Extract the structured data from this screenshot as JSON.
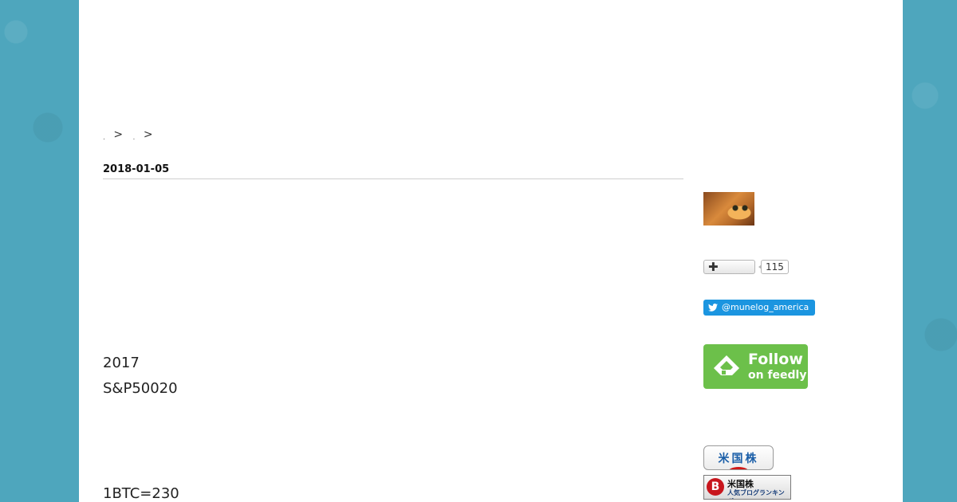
{
  "breadcrumb": {
    "separator_1": ">",
    "separator_2": ">"
  },
  "article": {
    "date": "2018-01-05",
    "line_1": "2017",
    "line_2": "S&P50020",
    "line_3": "1BTC=230"
  },
  "sidebar": {
    "hatena": {
      "plus_icon": "plus-icon",
      "count": "115"
    },
    "twitter": {
      "icon": "twitter-bird-icon",
      "handle": "@munelog_america"
    },
    "feedly": {
      "icon": "feedly-icon",
      "follow_label": "Follow",
      "on_label": "on feedly"
    },
    "ranking": {
      "badge1_label": "米国株",
      "badge2_logo": "B",
      "badge2_line1": "米国株",
      "badge2_line2": "人気ブログランキング"
    }
  },
  "colors": {
    "background": "#4ea6bd",
    "page": "#ffffff",
    "twitter_blue": "#1b95e0",
    "feedly_green": "#6cc04a",
    "ranking_red": "#c8161d"
  }
}
